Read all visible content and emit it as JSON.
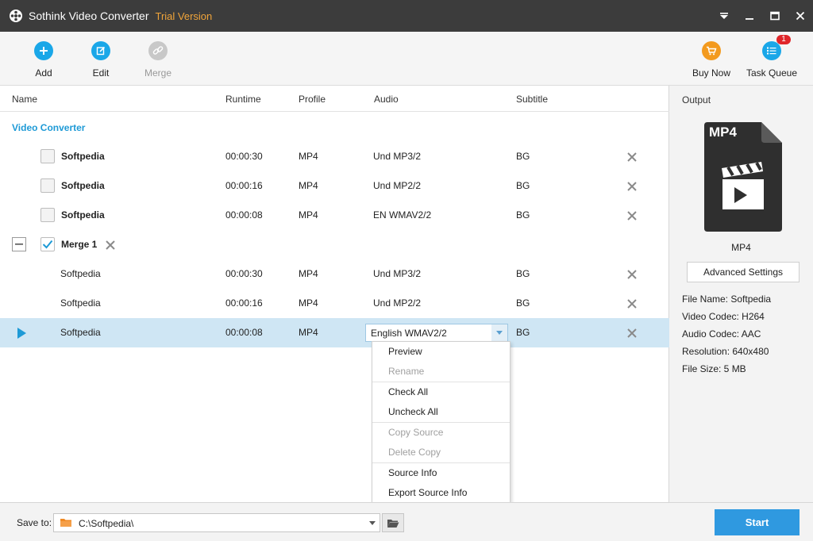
{
  "titlebar": {
    "app_name": "Sothink Video Converter",
    "trial_label": "Trial Version",
    "icons": [
      "film-reel-icon",
      "dropdown-menu-icon",
      "minimize-icon",
      "maximize-icon",
      "close-icon"
    ]
  },
  "toolbar": {
    "add_label": "Add",
    "edit_label": "Edit",
    "merge_label": "Merge",
    "buy_now_label": "Buy Now",
    "task_queue_label": "Task Queue",
    "task_queue_badge": "1",
    "colors": {
      "add": "#1aa7e8",
      "edit": "#1aa7e8",
      "merge": "#c8c8c8",
      "buy_now": "#f39a1e",
      "task_queue": "#1aa7e8",
      "badge": "#e0262a"
    }
  },
  "list": {
    "columns": [
      "Name",
      "Runtime",
      "Profile",
      "Audio",
      "Subtitle"
    ],
    "section_title": "Video Converter",
    "rows": [
      {
        "name": "Softpedia",
        "runtime": "00:00:30",
        "profile": "MP4",
        "audio": "Und  MP3/2",
        "subtitle": "BG"
      },
      {
        "name": "Softpedia",
        "runtime": "00:00:16",
        "profile": "MP4",
        "audio": "Und  MP2/2",
        "subtitle": "BG"
      },
      {
        "name": "Softpedia",
        "runtime": "00:00:08",
        "profile": "MP4",
        "audio": "EN  WMAV2/2",
        "subtitle": "BG"
      }
    ],
    "merge_group": {
      "name": "Merge 1",
      "checked": true,
      "rows": [
        {
          "name": "Softpedia",
          "runtime": "00:00:30",
          "profile": "MP4",
          "audio": "Und  MP3/2",
          "subtitle": "BG"
        },
        {
          "name": "Softpedia",
          "runtime": "00:00:16",
          "profile": "MP4",
          "audio": "Und  MP2/2",
          "subtitle": "BG"
        },
        {
          "name": "Softpedia",
          "runtime": "00:00:08",
          "profile": "MP4",
          "audio_select": "English WMAV2/2",
          "subtitle": "BG",
          "selected": true
        }
      ]
    },
    "selected_row_color": "#cfe6f4",
    "accent_color": "#1e9ad6"
  },
  "context_menu": {
    "groups": [
      [
        {
          "label": "Preview",
          "enabled": true
        },
        {
          "label": "Rename",
          "enabled": false
        }
      ],
      [
        {
          "label": "Check All",
          "enabled": true
        },
        {
          "label": "Uncheck All",
          "enabled": true
        }
      ],
      [
        {
          "label": "Copy Source",
          "enabled": false
        },
        {
          "label": "Delete Copy",
          "enabled": false
        }
      ],
      [
        {
          "label": "Source Info",
          "enabled": true
        },
        {
          "label": "Export Source Info",
          "enabled": true
        }
      ]
    ]
  },
  "output": {
    "label": "Output",
    "format_badge": "MP4",
    "format_name": "MP4",
    "advanced_label": "Advanced Settings",
    "info": [
      "File Name: Softpedia",
      "Video Codec: H264",
      "Audio Codec: AAC",
      "Resolution: 640x480",
      "File Size: 5 MB"
    ]
  },
  "bottom": {
    "save_to_label": "Save to:",
    "path": "C:\\Softpedia\\",
    "start_label": "Start",
    "start_color": "#2f99e0"
  }
}
